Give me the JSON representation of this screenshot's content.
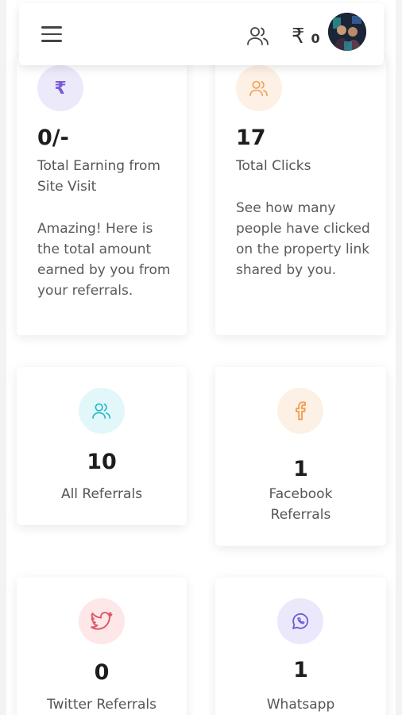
{
  "header": {
    "wallet_symbol": "₹",
    "wallet_amount": "0"
  },
  "cards": [
    {
      "value": "0/-",
      "label": "Total Earning from Site Visit",
      "description": "Amazing! Here is the total amount earned by you from your referrals.",
      "icon": "rupee-icon",
      "icon_color": "#7c5cd6",
      "icon_bg": "#ece9fb"
    },
    {
      "value": "17",
      "label": "Total Clicks",
      "description": "See how many people have clicked on the property link shared by you.",
      "icon": "people-icon",
      "icon_color": "#f0a35a",
      "icon_bg": "#fdf0e4"
    },
    {
      "value": "10",
      "label": "All Referrals",
      "icon": "people-icon",
      "icon_color": "#26b8c9",
      "icon_bg": "#e2f7f9"
    },
    {
      "value": "1",
      "label": "Facebook Referrals",
      "icon": "facebook-icon",
      "icon_color": "#f0a35a",
      "icon_bg": "#fdf0e4"
    },
    {
      "value": "0",
      "label": "Twitter Referrals",
      "icon": "twitter-icon",
      "icon_color": "#e05a6a",
      "icon_bg": "#fde7e9"
    },
    {
      "value": "1",
      "label": "Whatsapp",
      "icon": "whatsapp-icon",
      "icon_color": "#6a5cd6",
      "icon_bg": "#ebe8fb"
    }
  ]
}
